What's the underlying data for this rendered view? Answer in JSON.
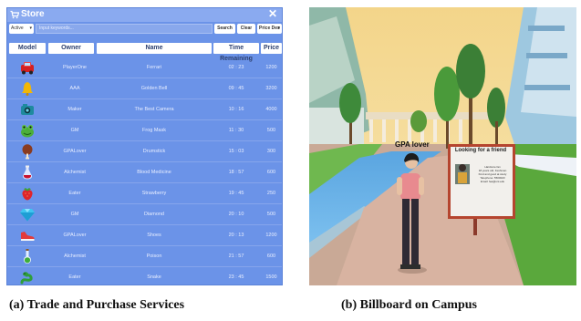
{
  "store": {
    "title": "Store",
    "icons": {
      "title_icon": "cart-icon",
      "close_icon": "close-icon"
    },
    "filter": {
      "status_value": "Active",
      "search_placeholder": "Input keywords...",
      "search_label": "Search",
      "clear_label": "Clear",
      "sort_value": "Price Des"
    },
    "columns": [
      "Model",
      "Owner",
      "Name",
      "Time Remaining",
      "Price"
    ],
    "rows": [
      {
        "icon": "car-icon",
        "owner": "PlayerOne",
        "name": "Ferrari",
        "time": "02 : 23",
        "price": "1200"
      },
      {
        "icon": "bell-icon",
        "owner": "AAA",
        "name": "Golden Bell",
        "time": "09 : 45",
        "price": "3200"
      },
      {
        "icon": "camera-icon",
        "owner": "Maker",
        "name": "The Best Camera",
        "time": "10 : 16",
        "price": "4000"
      },
      {
        "icon": "frog-icon",
        "owner": "GM",
        "name": "Frog Mask",
        "time": "11 : 30",
        "price": "500"
      },
      {
        "icon": "drumstick-icon",
        "owner": "GPALover",
        "name": "Drumstick",
        "time": "15 : 03",
        "price": "300"
      },
      {
        "icon": "potion-icon",
        "owner": "Alchemist",
        "name": "Blood Medicine",
        "time": "18 : 57",
        "price": "600"
      },
      {
        "icon": "strawberry-icon",
        "owner": "Eater",
        "name": "Strawberry",
        "time": "19 : 45",
        "price": "250"
      },
      {
        "icon": "diamond-icon",
        "owner": "GM",
        "name": "Diamond",
        "time": "20 : 10",
        "price": "500"
      },
      {
        "icon": "shoe-icon",
        "owner": "GPALover",
        "name": "Shoes",
        "time": "20 : 13",
        "price": "1200"
      },
      {
        "icon": "poison-icon",
        "owner": "Alchemist",
        "name": "Poison",
        "time": "21 : 57",
        "price": "600"
      },
      {
        "icon": "snake-icon",
        "owner": "Eater",
        "name": "Snake",
        "time": "23 : 45",
        "price": "1500"
      }
    ]
  },
  "scene": {
    "player_name": "GPA lover",
    "billboard_title": "Looking for a friend",
    "billboard_lines": [
      "Hardcore fan",
      "18 years old, freshman",
      "Kind and good at study",
      "Telephone: 5500023",
      "Email: fea@uni.edu"
    ]
  },
  "captions": {
    "a": "(a) Trade and Purchase Services",
    "b": "(b) Billboard on Campus"
  },
  "colors": {
    "panel": "#6b93e8",
    "header": "#8aaaf0"
  }
}
